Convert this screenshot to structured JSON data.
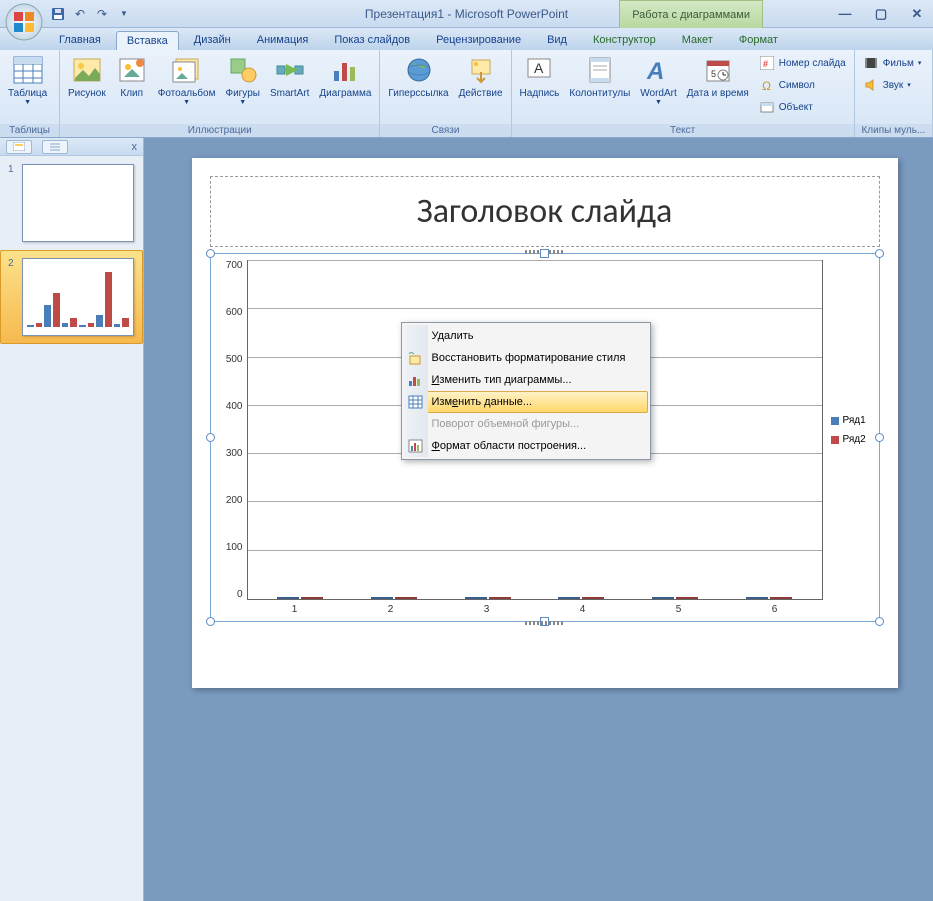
{
  "titlebar": {
    "doc_title": "Презентация1 - Microsoft PowerPoint",
    "chart_tools": "Работа с диаграммами"
  },
  "tabs": {
    "home": "Главная",
    "insert": "Вставка",
    "design": "Дизайн",
    "animation": "Анимация",
    "slideshow": "Показ слайдов",
    "review": "Рецензирование",
    "view": "Вид",
    "ctor": "Конструктор",
    "layout": "Макет",
    "format": "Формат"
  },
  "ribbon": {
    "tables": {
      "table": "Таблица",
      "group": "Таблицы"
    },
    "illus": {
      "picture": "Рисунок",
      "clip": "Клип",
      "album": "Фотоальбом",
      "shapes": "Фигуры",
      "smartart": "SmartArt",
      "chart": "Диаграмма",
      "group": "Иллюстрации"
    },
    "links": {
      "hyperlink": "Гиперссылка",
      "action": "Действие",
      "group": "Связи"
    },
    "text": {
      "textbox": "Надпись",
      "headerfooter": "Колонтитулы",
      "wordart": "WordArt",
      "datetime": "Дата и время",
      "slidenum": "Номер слайда",
      "symbol": "Символ",
      "object": "Объект",
      "group": "Текст"
    },
    "clips": {
      "movie": "Фильм",
      "sound": "Звук",
      "group": "Клипы муль..."
    }
  },
  "thumbs": {
    "n1": "1",
    "n2": "2",
    "close": "x"
  },
  "slide": {
    "title": "Заголовок слайда"
  },
  "legend": {
    "s1": "Ряд1",
    "s2": "Ряд2"
  },
  "ctx": {
    "delete": "Удалить",
    "restore": "Восстановить форматирование стиля",
    "changetype": "Изменить тип диаграммы...",
    "editdata": "Изменить данные...",
    "rotate3d": "Поворот объемной фигуры...",
    "formatarea": "Формат области построения..."
  },
  "chart_data": {
    "type": "bar",
    "categories": [
      "1",
      "2",
      "3",
      "4",
      "5",
      "6"
    ],
    "series": [
      {
        "name": "Ряд1",
        "values": [
          15,
          240,
          35,
          15,
          125,
          25
        ],
        "color": "#4a7ebb"
      },
      {
        "name": "Ряд2",
        "values": [
          30,
          370,
          90,
          30,
          615,
          100
        ],
        "color": "#be4b48"
      }
    ],
    "ylabel": "",
    "xlabel": "",
    "ylim": [
      0,
      700
    ],
    "yticks": [
      0,
      100,
      200,
      300,
      400,
      500,
      600,
      700
    ],
    "title": ""
  }
}
